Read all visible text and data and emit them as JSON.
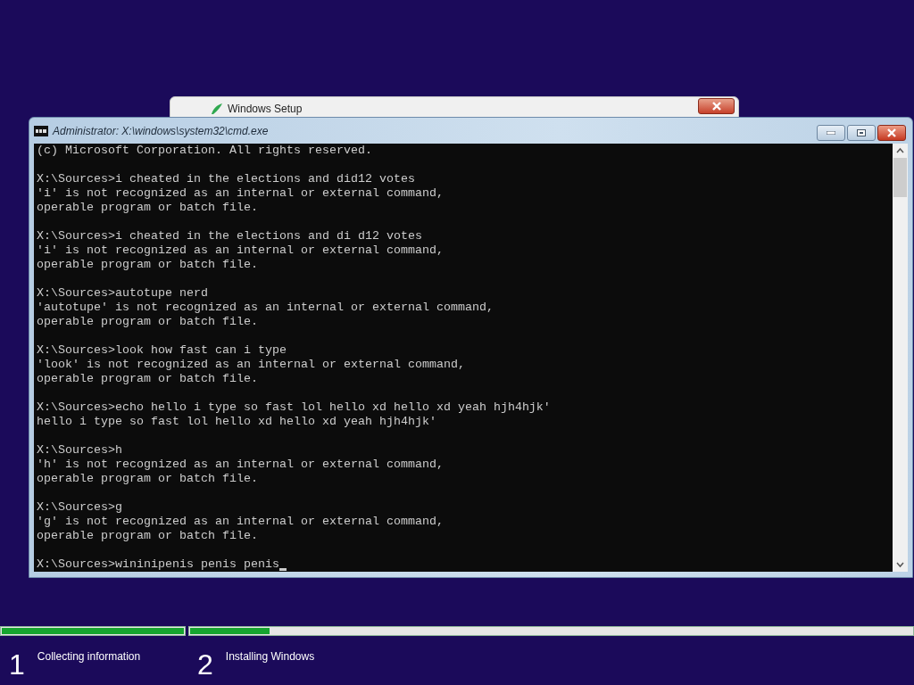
{
  "setup_window": {
    "title": "Windows Setup"
  },
  "cmd_window": {
    "title": "Administrator: X:\\windows\\system32\\cmd.exe"
  },
  "console": {
    "header": "(c) Microsoft Corporation. All rights reserved.",
    "entries": [
      {
        "command": "X:\\Sources>i cheated in the elections and did12 votes",
        "output": [
          "'i' is not recognized as an internal or external command,",
          "operable program or batch file."
        ]
      },
      {
        "command": "X:\\Sources>i cheated in the elections and di d12 votes",
        "output": [
          "'i' is not recognized as an internal or external command,",
          "operable program or batch file."
        ]
      },
      {
        "command": "X:\\Sources>autotupe nerd",
        "output": [
          "'autotupe' is not recognized as an internal or external command,",
          "operable program or batch file."
        ]
      },
      {
        "command": "X:\\Sources>look how fast can i type",
        "output": [
          "'look' is not recognized as an internal or external command,",
          "operable program or batch file."
        ]
      },
      {
        "command": "X:\\Sources>echo hello i type so fast lol hello xd hello xd yeah hjh4hjk'",
        "output": [
          "hello i type so fast lol hello xd hello xd yeah hjh4hjk'"
        ]
      },
      {
        "command": "X:\\Sources>h",
        "output": [
          "'h' is not recognized as an internal or external command,",
          "operable program or batch file."
        ]
      },
      {
        "command": "X:\\Sources>g",
        "output": [
          "'g' is not recognized as an internal or external command,",
          "operable program or batch file."
        ]
      }
    ],
    "current_line": "X:\\Sources>wininipenis penis penis"
  },
  "progress": [
    {
      "number": "1",
      "label": "Collecting information",
      "level": 1
    },
    {
      "number": "2",
      "label": "Installing Windows",
      "level": 0.11
    }
  ]
}
